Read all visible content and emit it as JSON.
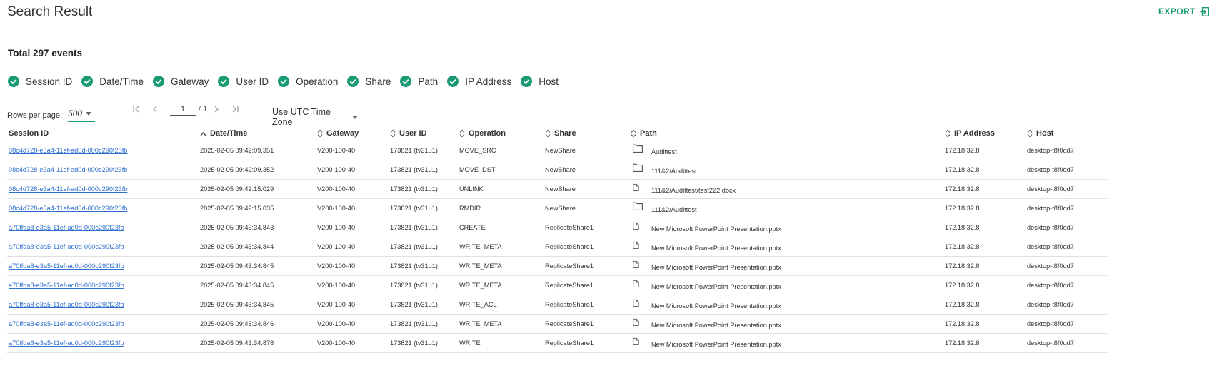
{
  "header": {
    "title": "Search Result",
    "export_label": "EXPORT",
    "total_label": "Total 297 events"
  },
  "filters": [
    "Session ID",
    "Date/Time",
    "Gateway",
    "User ID",
    "Operation",
    "Share",
    "Path",
    "IP Address",
    "Host"
  ],
  "pagination": {
    "rows_per_page_label": "Rows per page:",
    "rows_per_page_value": "500",
    "page_value": "1",
    "total_pages": "/ 1"
  },
  "timezone": {
    "label": "Use UTC Time Zone"
  },
  "table": {
    "columns": [
      "Session ID",
      "Date/Time",
      "Gateway",
      "User ID",
      "Operation",
      "Share",
      "Path",
      "IP Address",
      "Host"
    ],
    "rows": [
      {
        "session": "08c4d728-e3a4-11ef-ad0d-000c290f23fb",
        "datetime": "2025-02-05 09:42:09.351",
        "gateway": "V200-100-40",
        "user": "173821 (tv31u1)",
        "operation": "MOVE_SRC",
        "share": "NewShare",
        "path_icon": "folder-icon",
        "path": "Audittest",
        "ip": "172.18.32.8",
        "host": "desktop-t8f0qd7"
      },
      {
        "session": "08c4d728-e3a4-11ef-ad0d-000c290f23fb",
        "datetime": "2025-02-05 09:42:09.352",
        "gateway": "V200-100-40",
        "user": "173821 (tv31u1)",
        "operation": "MOVE_DST",
        "share": "NewShare",
        "path_icon": "folder-icon",
        "path": "111&2/Audittest",
        "ip": "172.18.32.8",
        "host": "desktop-t8f0qd7"
      },
      {
        "session": "08c4d728-e3a4-11ef-ad0d-000c290f23fb",
        "datetime": "2025-02-05 09:42:15.029",
        "gateway": "V200-100-40",
        "user": "173821 (tv31u1)",
        "operation": "UNLINK",
        "share": "NewShare",
        "path_icon": "file-icon",
        "path": "111&2/Audittest/test222.docx",
        "ip": "172.18.32.8",
        "host": "desktop-t8f0qd7"
      },
      {
        "session": "08c4d728-e3a4-11ef-ad0d-000c290f23fb",
        "datetime": "2025-02-05 09:42:15.035",
        "gateway": "V200-100-40",
        "user": "173821 (tv31u1)",
        "operation": "RMDIR",
        "share": "NewShare",
        "path_icon": "folder-icon",
        "path": "111&2/Audittest",
        "ip": "172.18.32.8",
        "host": "desktop-t8f0qd7"
      },
      {
        "session": "a70ffda8-e3a5-11ef-ad0d-000c290f23fb",
        "datetime": "2025-02-05 09:43:34.843",
        "gateway": "V200-100-40",
        "user": "173821 (tv31u1)",
        "operation": "CREATE",
        "share": "ReplicateShare1",
        "path_icon": "file-icon",
        "path": "New Microsoft PowerPoint Presentation.pptx",
        "ip": "172.18.32.8",
        "host": "desktop-t8f0qd7"
      },
      {
        "session": "a70ffda8-e3a5-11ef-ad0d-000c290f23fb",
        "datetime": "2025-02-05 09:43:34.844",
        "gateway": "V200-100-40",
        "user": "173821 (tv31u1)",
        "operation": "WRITE_META",
        "share": "ReplicateShare1",
        "path_icon": "file-icon",
        "path": "New Microsoft PowerPoint Presentation.pptx",
        "ip": "172.18.32.8",
        "host": "desktop-t8f0qd7"
      },
      {
        "session": "a70ffda8-e3a5-11ef-ad0d-000c290f23fb",
        "datetime": "2025-02-05 09:43:34.845",
        "gateway": "V200-100-40",
        "user": "173821 (tv31u1)",
        "operation": "WRITE_META",
        "share": "ReplicateShare1",
        "path_icon": "file-icon",
        "path": "New Microsoft PowerPoint Presentation.pptx",
        "ip": "172.18.32.8",
        "host": "desktop-t8f0qd7"
      },
      {
        "session": "a70ffda8-e3a5-11ef-ad0d-000c290f23fb",
        "datetime": "2025-02-05 09:43:34.845",
        "gateway": "V200-100-40",
        "user": "173821 (tv31u1)",
        "operation": "WRITE_META",
        "share": "ReplicateShare1",
        "path_icon": "file-icon",
        "path": "New Microsoft PowerPoint Presentation.pptx",
        "ip": "172.18.32.8",
        "host": "desktop-t8f0qd7"
      },
      {
        "session": "a70ffda8-e3a5-11ef-ad0d-000c290f23fb",
        "datetime": "2025-02-05 09:43:34.845",
        "gateway": "V200-100-40",
        "user": "173821 (tv31u1)",
        "operation": "WRITE_ACL",
        "share": "ReplicateShare1",
        "path_icon": "file-icon",
        "path": "New Microsoft PowerPoint Presentation.pptx",
        "ip": "172.18.32.8",
        "host": "desktop-t8f0qd7"
      },
      {
        "session": "a70ffda8-e3a5-11ef-ad0d-000c290f23fb",
        "datetime": "2025-02-05 09:43:34.846",
        "gateway": "V200-100-40",
        "user": "173821 (tv31u1)",
        "operation": "WRITE_META",
        "share": "ReplicateShare1",
        "path_icon": "file-icon",
        "path": "New Microsoft PowerPoint Presentation.pptx",
        "ip": "172.18.32.8",
        "host": "desktop-t8f0qd7"
      },
      {
        "session": "a70ffda8-e3a5-11ef-ad0d-000c290f23fb",
        "datetime": "2025-02-05 09:43:34.878",
        "gateway": "V200-100-40",
        "user": "173821 (tv31u1)",
        "operation": "WRITE",
        "share": "ReplicateShare1",
        "path_icon": "file-icon",
        "path": "New Microsoft PowerPoint Presentation.pptx",
        "ip": "172.18.32.8",
        "host": "desktop-t8f0qd7"
      }
    ]
  },
  "colors": {
    "accent": "#1a9a74",
    "link": "#2f6fd0",
    "divider": "#e0e0e0"
  },
  "icons": {
    "export": "export-icon",
    "check": "check-circle-icon",
    "folder": "folder-icon",
    "file": "file-icon"
  }
}
